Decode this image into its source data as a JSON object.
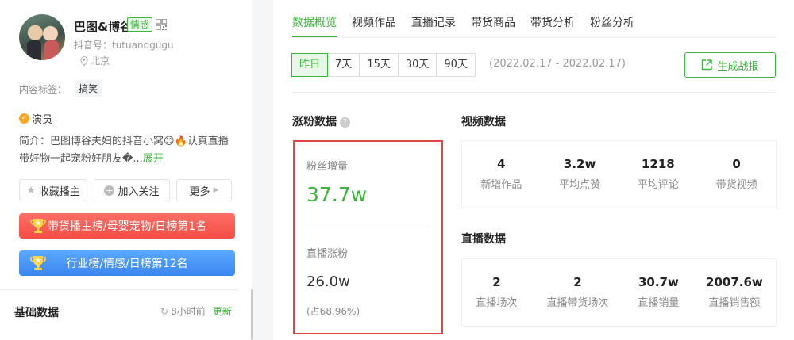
{
  "profile": {
    "name": "巴图&博谷",
    "emotion_tag": "情感",
    "douyin_id": "抖音号：tutuandgugu",
    "location": "北京",
    "content_tag_label": "内容标签：",
    "content_tag": "搞笑",
    "role": "演员",
    "bio_prefix": "简介：",
    "bio_text": "巴图博谷夫妇的抖音小窝😊🔥认真直播带好物一起宠粉好朋友�...",
    "bio_more": "展开",
    "buttons": {
      "collect": "收藏播主",
      "follow": "加入关注",
      "more": "更多"
    },
    "ranks": {
      "red": "带货播主榜/母婴宠物/日榜第1名",
      "blue": "行业榜/情感/日榜第12名"
    },
    "basic_title": "基础数据",
    "updated_time": "8小时前",
    "update_link": "更新"
  },
  "tabs": [
    "数据概览",
    "视频作品",
    "直播记录",
    "带货商品",
    "带货分析",
    "粉丝分析"
  ],
  "ranges": [
    "昨日",
    "7天",
    "15天",
    "30天",
    "90天"
  ],
  "date_range": "(2022.02.17 - 2022.02.17)",
  "report_button": "生成战报",
  "fans": {
    "title": "涨粉数据",
    "growth_label": "粉丝增量",
    "growth_value": "37.7w",
    "live_label": "直播涨粉",
    "live_value": "26.0w",
    "live_pct": "(占68.96%)"
  },
  "video": {
    "title": "视频数据",
    "stats": [
      {
        "value": "4",
        "label": "新增作品"
      },
      {
        "value": "3.2w",
        "label": "平均点赞"
      },
      {
        "value": "1218",
        "label": "平均评论"
      },
      {
        "value": "0",
        "label": "带货视频"
      }
    ]
  },
  "live": {
    "title": "直播数据",
    "stats": [
      {
        "value": "2",
        "label": "直播场次"
      },
      {
        "value": "2",
        "label": "直播带货场次"
      },
      {
        "value": "30.7w",
        "label": "直播销量"
      },
      {
        "value": "2007.6w",
        "label": "直播销售额"
      }
    ]
  },
  "colors": {
    "accent": "#3cb53c",
    "highlight_border": "#e04646",
    "rank_red": "#f34d44",
    "rank_blue": "#3b86f0"
  }
}
